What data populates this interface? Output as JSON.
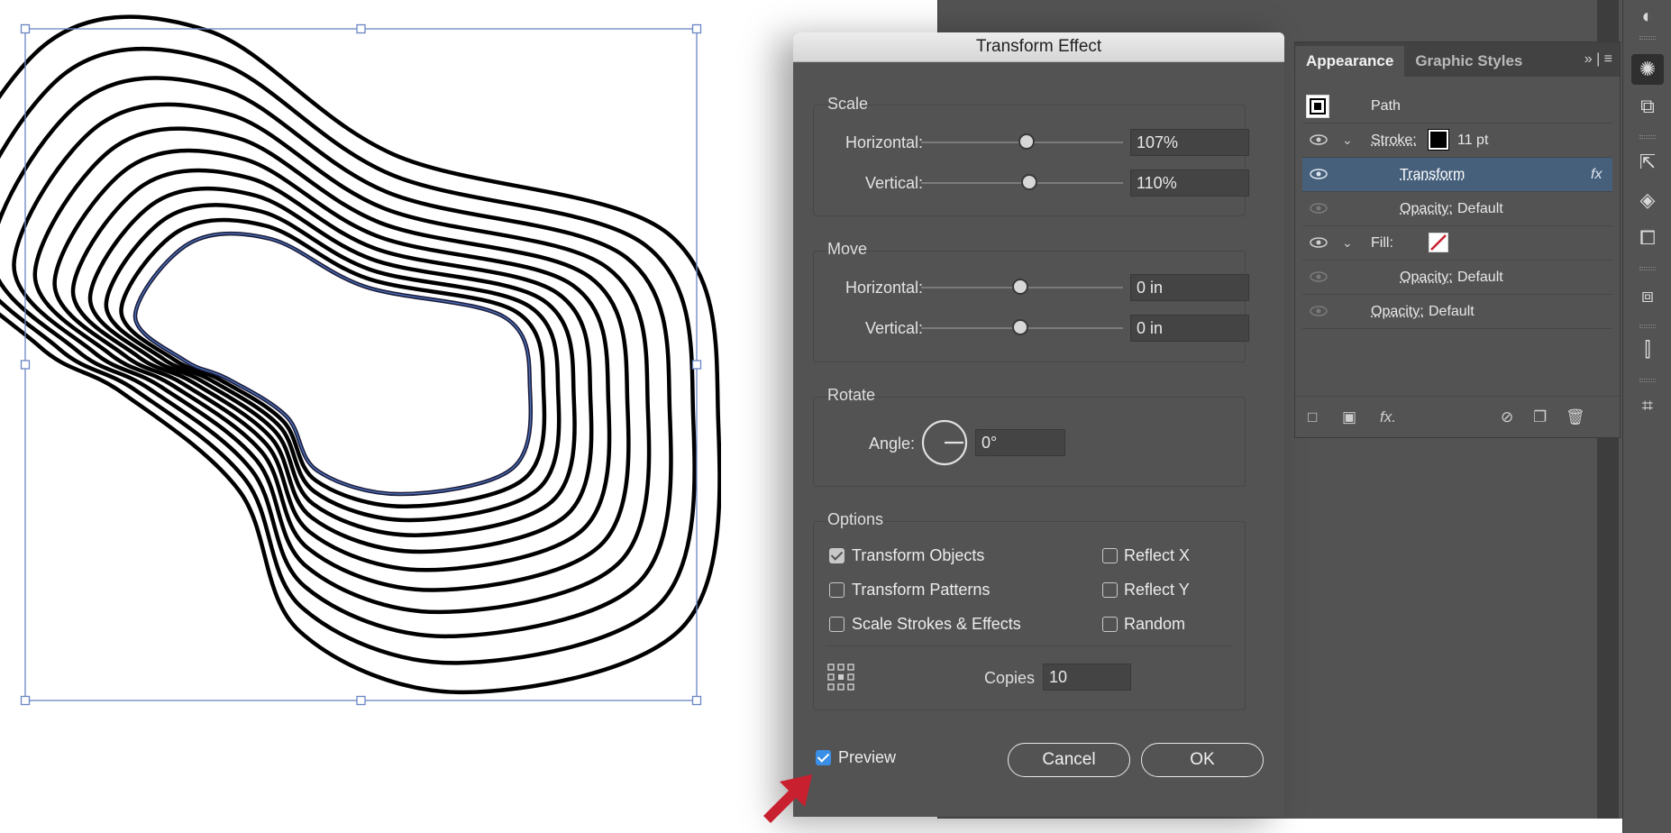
{
  "dialog": {
    "title": "Transform Effect",
    "scale": {
      "title": "Scale",
      "horizontal_label": "Horizontal:",
      "horizontal_value": "107%",
      "vertical_label": "Vertical:",
      "vertical_value": "110%"
    },
    "move": {
      "title": "Move",
      "horizontal_label": "Horizontal:",
      "horizontal_value": "0 in",
      "vertical_label": "Vertical:",
      "vertical_value": "0 in"
    },
    "rotate": {
      "title": "Rotate",
      "angle_label": "Angle:",
      "angle_value": "0°"
    },
    "options": {
      "title": "Options",
      "transform_objects": "Transform Objects",
      "transform_patterns": "Transform Patterns",
      "scale_strokes": "Scale Strokes & Effects",
      "reflect_x": "Reflect X",
      "reflect_y": "Reflect Y",
      "random": "Random",
      "copies_label": "Copies",
      "copies_value": "10"
    },
    "preview_label": "Preview",
    "cancel_label": "Cancel",
    "ok_label": "OK"
  },
  "appearance": {
    "tab_appearance": "Appearance",
    "tab_graphic_styles": "Graphic Styles",
    "path_label": "Path",
    "stroke_label": "Stroke:",
    "stroke_weight": "11 pt",
    "transform_label": "Transform",
    "fx_label": "fx",
    "opacity_label": "Opacity:",
    "opacity_value": "Default",
    "fill_label": "Fill:"
  },
  "colors": {
    "selection_blue": "#4a6fb5",
    "preview_checkbox": "#3a8ee6",
    "arrow_red": "#c8202f",
    "selected_row": "#46607c"
  }
}
